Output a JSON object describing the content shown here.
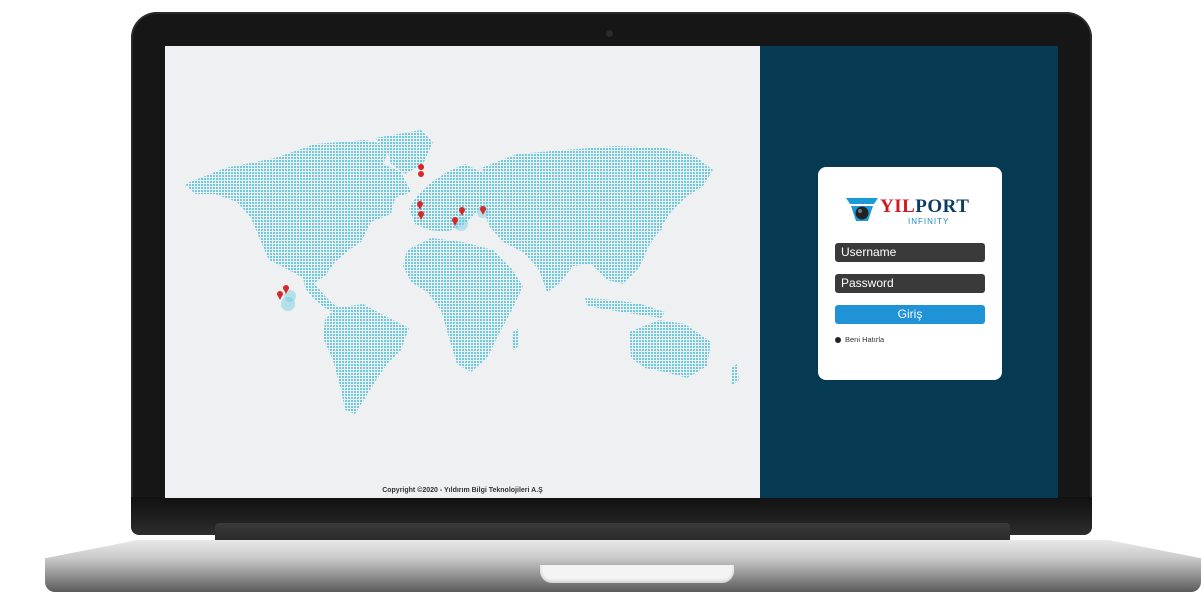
{
  "login": {
    "brand_part1": "YIL",
    "brand_part2": "PORT",
    "brand_sub": "INFINITY",
    "username_placeholder": "Username",
    "password_placeholder": "Password",
    "submit_label": "Giriş",
    "remember_label": "Beni Hatırla"
  },
  "footer": {
    "copyright": "Copyright ©2020 - Yıldırım Bilgi Teknolojileri A.Ş"
  },
  "colors": {
    "map_dots": "#6ecbdf",
    "marker": "#d62828",
    "side_panel": "#053a52",
    "submit": "#1f93d6"
  },
  "icons": {
    "marker": "map-pin-icon",
    "logo_mark": "yilport-logo-icon"
  }
}
